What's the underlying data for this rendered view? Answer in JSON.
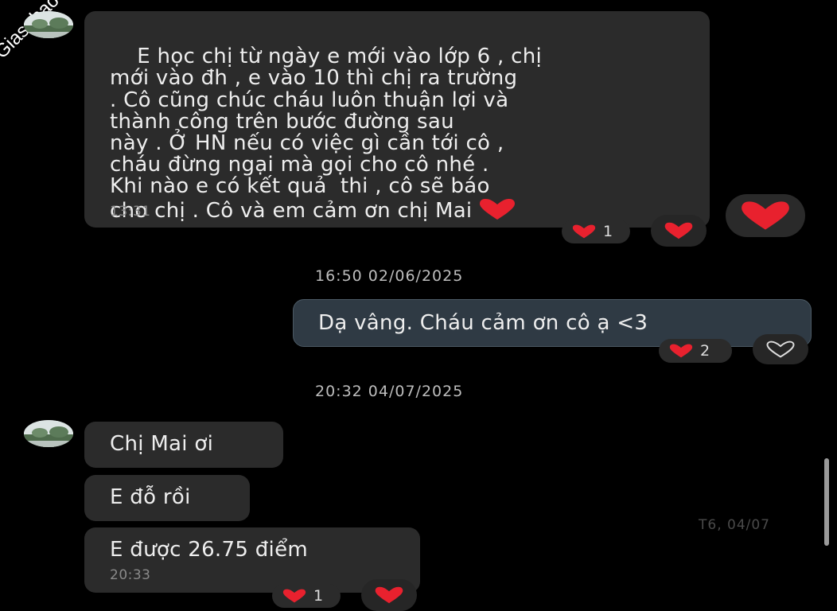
{
  "watermark": "Giasubaochau.net",
  "messages": {
    "m1": {
      "text": "E học chị từ ngày e mới vào lớp 6 , chị\nmới vào đh , e vào 10 thì chị ra trường\n. Cô cũng chúc cháu luôn thuận lợi và\nthành công trên bước đường sau\nnày . Ở HN nếu có việc gì cần tới cô ,\ncháu đừng ngại mà gọi cho cô nhé .\nKhi nào e có kết quả  thi , cô sẽ báo\ncho chị . Cô và em cảm ơn chị Mai",
      "time": "13:31",
      "reaction_count": "1"
    },
    "sep1": "16:50 02/06/2025",
    "m2": {
      "text": "Dạ vâng. Cháu cảm ơn cô ạ <3",
      "reaction_count": "2"
    },
    "sep2": "20:32 04/07/2025",
    "m3": {
      "text": "Chị Mai ơi"
    },
    "m4": {
      "text": "E đỗ rồi"
    },
    "m5": {
      "text": "E được 26.75 điểm",
      "time": "20:33",
      "reaction_count": "1"
    },
    "side_date": "T6, 04/07"
  },
  "colors": {
    "heart": "#e8212e",
    "bubble_in": "#2b2b2b",
    "bubble_out": "#2f3a44"
  },
  "icons": {
    "reaction": "heart-icon",
    "react_empty": "heart-outline-icon"
  }
}
